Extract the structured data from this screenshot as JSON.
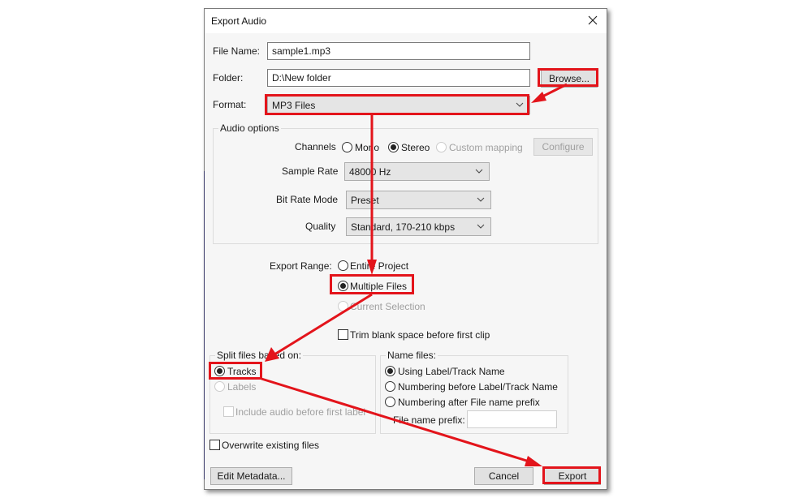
{
  "dialog": {
    "title": "Export Audio",
    "close_icon": "close-icon"
  },
  "file_name": {
    "label": "File Name:",
    "value": "sample1.mp3"
  },
  "folder": {
    "label": "Folder:",
    "value": "D:\\New folder",
    "browse_label": "Browse..."
  },
  "format": {
    "label": "Format:",
    "value": "MP3 Files"
  },
  "audio_options": {
    "title": "Audio options",
    "channels": {
      "label": "Channels",
      "options": [
        {
          "label": "Mono",
          "selected": false,
          "enabled": true
        },
        {
          "label": "Stereo",
          "selected": true,
          "enabled": true
        },
        {
          "label": "Custom mapping",
          "selected": false,
          "enabled": false
        }
      ],
      "configure_label": "Configure"
    },
    "sample_rate": {
      "label": "Sample Rate",
      "value": "48000 Hz"
    },
    "bit_rate_mode": {
      "label": "Bit Rate Mode",
      "value": "Preset"
    },
    "quality": {
      "label": "Quality",
      "value": "Standard, 170-210 kbps"
    }
  },
  "export_range": {
    "label": "Export Range:",
    "options": [
      {
        "label": "Entire Project",
        "selected": false,
        "enabled": true
      },
      {
        "label": "Multiple Files",
        "selected": true,
        "enabled": true
      },
      {
        "label": "Current Selection",
        "selected": false,
        "enabled": false
      }
    ],
    "trim_label": "Trim blank space before first clip",
    "trim_checked": false
  },
  "split_files": {
    "title": "Split files based on:",
    "options": [
      {
        "label": "Tracks",
        "selected": true,
        "enabled": true
      },
      {
        "label": "Labels",
        "selected": false,
        "enabled": false
      }
    ],
    "include_audio_label": "Include audio before first label",
    "include_audio_checked": false
  },
  "name_files": {
    "title": "Name files:",
    "options": [
      {
        "label": "Using Label/Track Name",
        "selected": true
      },
      {
        "label": "Numbering before Label/Track Name",
        "selected": false
      },
      {
        "label": "Numbering after File name prefix",
        "selected": false
      }
    ],
    "prefix_label": "File name prefix:",
    "prefix_value": ""
  },
  "overwrite": {
    "label": "Overwrite existing files",
    "checked": false
  },
  "buttons": {
    "edit_metadata": "Edit Metadata...",
    "cancel": "Cancel",
    "export": "Export"
  },
  "annotation_color": "#e3141b"
}
